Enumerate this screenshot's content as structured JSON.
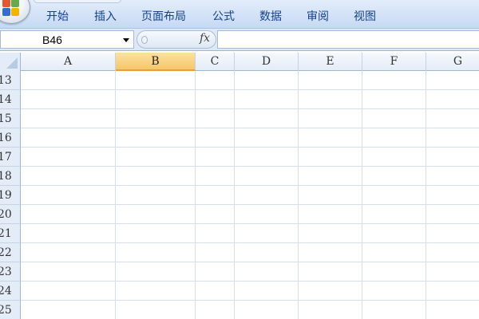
{
  "ribbon": {
    "tabs": [
      {
        "label": "开始"
      },
      {
        "label": "插入"
      },
      {
        "label": "页面布局"
      },
      {
        "label": "公式"
      },
      {
        "label": "数据"
      },
      {
        "label": "审阅"
      },
      {
        "label": "视图"
      }
    ]
  },
  "formula_bar": {
    "name_box_value": "B46",
    "fx_label": "fx",
    "formula_value": ""
  },
  "sheet": {
    "columns": [
      "A",
      "B",
      "C",
      "D",
      "E",
      "F",
      "G"
    ],
    "selected_column": "B",
    "rows": [
      "13",
      "14",
      "15",
      "16",
      "17",
      "18",
      "19",
      "20",
      "21",
      "22",
      "23",
      "24",
      "25"
    ]
  },
  "colors": {
    "selected_header": "#f6c66b",
    "ribbon_text": "#15428b",
    "grid_line": "#d5dee9"
  }
}
